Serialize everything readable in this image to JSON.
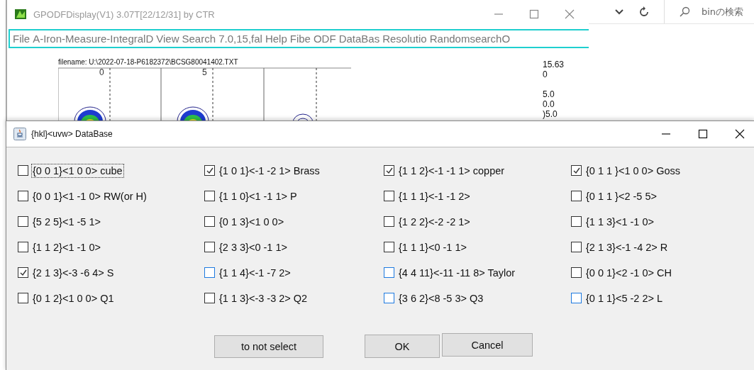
{
  "main_window": {
    "title": "GPODFDisplay(V1) 3.07T[22/12/31] by CTR",
    "menu": [
      "File",
      "A-Iron-Measure-IntegralD",
      "View",
      "Search 7.0,15,fal",
      "Help",
      "Fibe",
      "ODF",
      "DataBas",
      "Resolutio",
      "RandomsearchO"
    ],
    "filename": "filename: U:\\2022-07-18-P6182372\\BCSG80041402.TXT",
    "panel_labels": [
      "0",
      "5"
    ],
    "scale_labels": [
      "15.63",
      "0",
      "5.0",
      "0.0",
      ")5.0"
    ]
  },
  "explorer": {
    "search": {
      "placeholder": "binの検索"
    }
  },
  "dialog": {
    "title": "{hkl}<uvw> DataBase",
    "options": [
      {
        "label": "{0 0 1}<1 0 0> cube",
        "checked": false,
        "kind": "plain",
        "focused": true
      },
      {
        "label": "{1 0 1}<-1 -2 1> Brass",
        "checked": true,
        "kind": "plain",
        "focused": false
      },
      {
        "label": "{1 1 2}<-1 -1 1> copper",
        "checked": true,
        "kind": "plain",
        "focused": false
      },
      {
        "label": "{0 1 1 }<1 0 0> Goss",
        "checked": true,
        "kind": "plain",
        "focused": false
      },
      {
        "label": "{0 0 1}<1 -1 0> RW(or H)",
        "checked": false,
        "kind": "plain",
        "focused": false
      },
      {
        "label": "{1 1 0}<1 -1 1> P",
        "checked": false,
        "kind": "plain",
        "focused": false
      },
      {
        "label": "{1 1 1}<-1 -1 2>",
        "checked": false,
        "kind": "plain",
        "focused": false
      },
      {
        "label": "{0 1 1 }<2 -5 5>",
        "checked": false,
        "kind": "plain",
        "focused": false
      },
      {
        "label": "{5 2 5}<1 -5 1>",
        "checked": false,
        "kind": "plain",
        "focused": false
      },
      {
        "label": "{0 1 3}<1 0 0>",
        "checked": false,
        "kind": "plain",
        "focused": false
      },
      {
        "label": "{1 2 2}<-2 -2 1>",
        "checked": false,
        "kind": "plain",
        "focused": false
      },
      {
        "label": "{1 1 3}<1 -1 0>",
        "checked": false,
        "kind": "plain",
        "focused": false
      },
      {
        "label": "{1 1 2}<1 -1 0>",
        "checked": false,
        "kind": "plain",
        "focused": false
      },
      {
        "label": "{2 3 3}<0 -1 1>",
        "checked": false,
        "kind": "plain",
        "focused": false
      },
      {
        "label": "{1 1 1}<0 -1 1>",
        "checked": false,
        "kind": "plain",
        "focused": false
      },
      {
        "label": "{2 1 3}<-1 -4 2> R",
        "checked": false,
        "kind": "plain",
        "focused": false
      },
      {
        "label": "{2 1 3}<-3 -6 4> S",
        "checked": true,
        "kind": "plain",
        "focused": false
      },
      {
        "label": "{1 1 4}<-1 -7 2>",
        "checked": false,
        "kind": "accent",
        "focused": false
      },
      {
        "label": "{4 4 11}<-11 -11 8> Taylor",
        "checked": false,
        "kind": "accent",
        "focused": false
      },
      {
        "label": "{0 0 1}<2 -1 0> CH",
        "checked": false,
        "kind": "plain",
        "focused": false
      },
      {
        "label": "{0 1 2}<1 0 0> Q1",
        "checked": false,
        "kind": "plain",
        "focused": false
      },
      {
        "label": "{1 1 3}<-3 -3 2> Q2",
        "checked": false,
        "kind": "plain",
        "focused": false
      },
      {
        "label": "{3 6 2}<8 -5 3> Q3",
        "checked": false,
        "kind": "accent",
        "focused": false
      },
      {
        "label": "{0 1 1}<5 -2 2> L",
        "checked": false,
        "kind": "accent",
        "focused": false
      }
    ],
    "buttons": [
      "to not select",
      "OK",
      "Cancel"
    ]
  }
}
